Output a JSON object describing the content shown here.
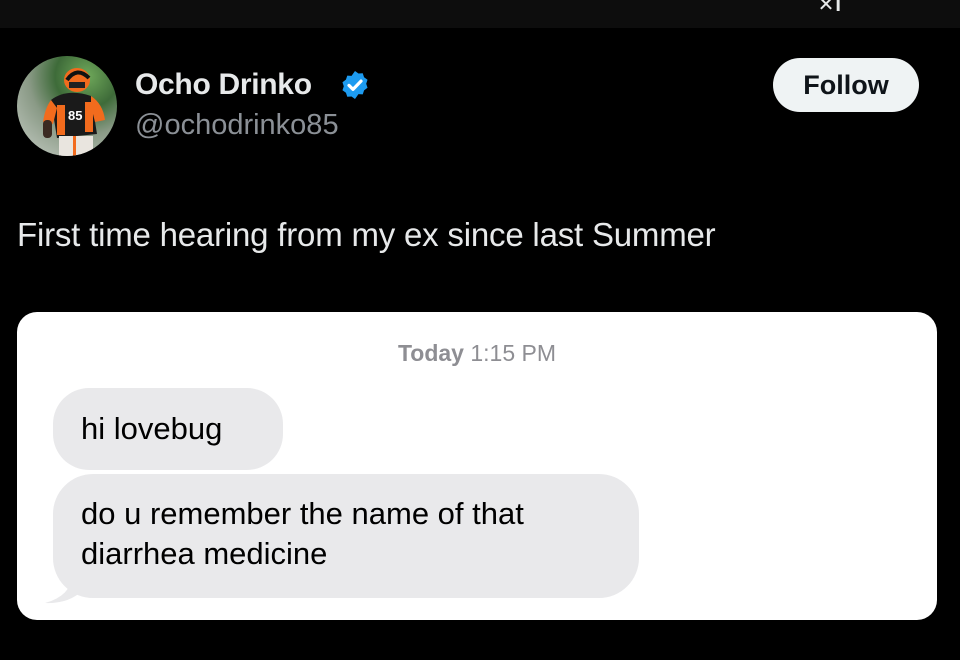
{
  "author": {
    "display_name": "Ocho Drinko",
    "handle": "@ochodrinko85",
    "verified": true,
    "avatar_jersey_number": "85"
  },
  "follow_button": {
    "label": "Follow"
  },
  "tweet": {
    "text": "First time hearing from my ex since last Summer"
  },
  "media": {
    "timestamp_day": "Today",
    "timestamp_time": "1:15 PM",
    "messages": [
      {
        "text": "hi lovebug"
      },
      {
        "text_line1": "do u remember the name of that",
        "text_line2": "diarrhea medicine"
      }
    ]
  },
  "colors": {
    "background": "#000000",
    "primary_text": "#e7e9ea",
    "secondary_text": "#8b9096",
    "verified_badge": "#1d9bf0",
    "follow_button_bg": "#eff3f4",
    "bubble_bg": "#e9e9eb"
  },
  "icons": {
    "verified": "verified-badge-icon"
  }
}
